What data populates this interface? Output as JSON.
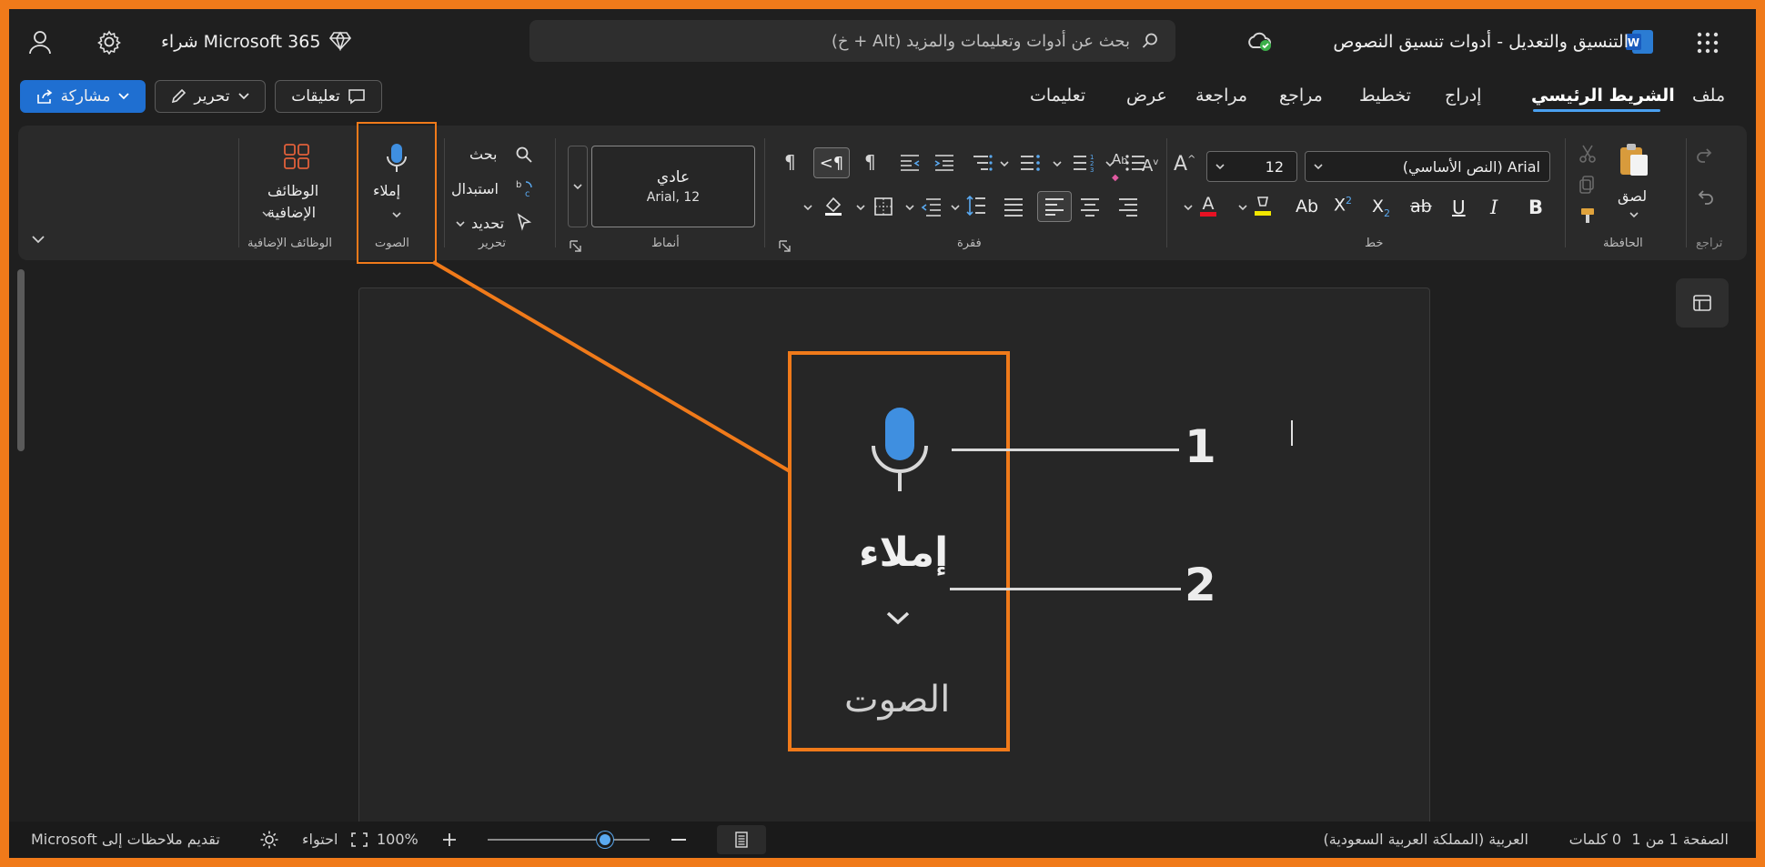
{
  "titlebar": {
    "doc_title": "التنسيق والتعديل - أدوات تنسيق النصوص",
    "search_placeholder": "بحث عن أدوات وتعليمات والمزيد (Alt + خ)",
    "buy_label": "شراء Microsoft 365"
  },
  "tabs": [
    {
      "label": "ملف"
    },
    {
      "label": "الشريط الرئيسي",
      "active": true
    },
    {
      "label": "إدراج"
    },
    {
      "label": "تخطيط"
    },
    {
      "label": "مراجع"
    },
    {
      "label": "مراجعة"
    },
    {
      "label": "عرض"
    },
    {
      "label": "تعليمات"
    }
  ],
  "topbuttons": {
    "comments": "تعليقات",
    "edit": "تحرير",
    "share": "مشاركة"
  },
  "ribbon": {
    "undo_group": "تراجع",
    "clipboard": {
      "label": "الحافظة",
      "paste": "لصق"
    },
    "font": {
      "label": "خط",
      "font_name": "Arial (النص الأساسي)",
      "font_size": "12"
    },
    "paragraph": {
      "label": "فقرة"
    },
    "styles": {
      "label": "أنماط",
      "style_name": "عادي",
      "style_detail": "Arial, 12"
    },
    "editing": {
      "label": "تحرير",
      "find": "بحث",
      "replace": "استبدال",
      "select": "تحديد"
    },
    "voice": {
      "label": "الصوت",
      "dictate": "إملاء"
    },
    "addins": {
      "label": "الوظائف الإضافية",
      "button_line1": "الوظائف",
      "button_line2": "الإضافية"
    }
  },
  "zoom": {
    "dictate": "إملاء",
    "group": "الصوت",
    "callout1": "1",
    "callout2": "2"
  },
  "statusbar": {
    "page": "الصفحة 1 من 1",
    "words": "0 كلمات",
    "language": "العربية (المملكة العربية السعودية)",
    "zoom": "100%",
    "fit": "احتواء",
    "feedback": "تقديم ملاحظات إلى Microsoft"
  },
  "colors": {
    "accent_orange": "#f07a1a",
    "share_blue": "#1f6fd1",
    "mic_blue": "#3f8fe0",
    "tab_underline": "#4aa0f0"
  }
}
